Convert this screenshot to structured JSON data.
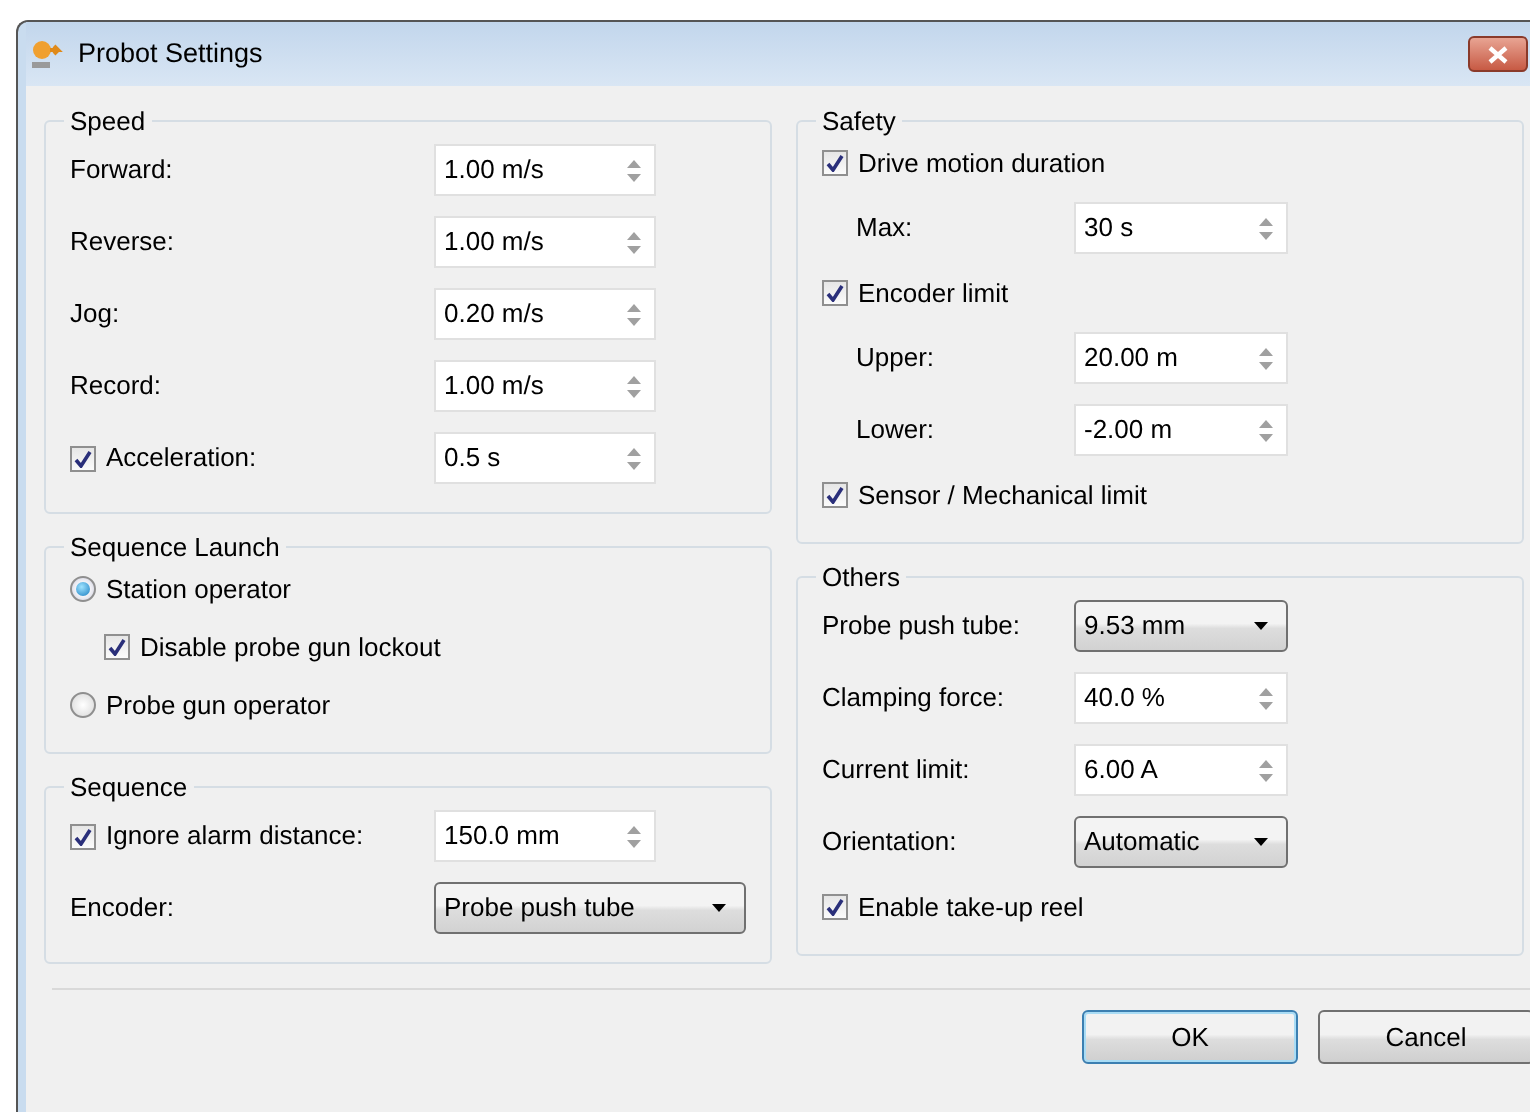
{
  "window": {
    "title": "Probot Settings"
  },
  "left_column": [
    {
      "title": "Speed",
      "items": [
        {
          "kind": "spin",
          "label": "Forward:",
          "value": "1.00 m/s"
        },
        {
          "kind": "spin",
          "label": "Reverse:",
          "value": "1.00 m/s"
        },
        {
          "kind": "spin",
          "label": "Jog:",
          "value": "0.20 m/s"
        },
        {
          "kind": "spin",
          "label": "Record:",
          "value": "1.00 m/s"
        },
        {
          "kind": "check_spin",
          "label": "Acceleration:",
          "checked": true,
          "value": "0.5 s"
        }
      ]
    },
    {
      "title": "Sequence Launch",
      "items": [
        {
          "kind": "radio",
          "label": "Station operator",
          "selected": true,
          "children": [
            {
              "kind": "check",
              "label": "Disable probe gun lockout",
              "checked": true
            }
          ]
        },
        {
          "kind": "radio",
          "label": "Probe gun operator",
          "selected": false
        }
      ]
    },
    {
      "title": "Sequence",
      "items": [
        {
          "kind": "check_spin",
          "label": "Ignore alarm distance:",
          "checked": true,
          "value": "150.0 mm"
        },
        {
          "kind": "combo",
          "label": "Encoder:",
          "value": "Probe push tube"
        }
      ]
    }
  ],
  "right_column": [
    {
      "title": "Safety",
      "items": [
        {
          "kind": "check",
          "label": "Drive motion duration",
          "checked": true,
          "children": [
            {
              "kind": "spin",
              "label": "Max:",
              "value": "30 s"
            }
          ]
        },
        {
          "kind": "check",
          "label": "Encoder limit",
          "checked": true,
          "children": [
            {
              "kind": "spin",
              "label": "Upper:",
              "value": "20.00 m"
            },
            {
              "kind": "spin",
              "label": "Lower:",
              "value": "-2.00 m"
            }
          ]
        },
        {
          "kind": "check",
          "label": "Sensor / Mechanical limit",
          "checked": true
        }
      ]
    },
    {
      "title": "Others",
      "items": [
        {
          "kind": "combo",
          "label": "Probe push tube:",
          "value": "9.53 mm"
        },
        {
          "kind": "spin",
          "label": "Clamping force:",
          "value": "40.0 %"
        },
        {
          "kind": "spin",
          "label": "Current limit:",
          "value": "6.00 A"
        },
        {
          "kind": "combo",
          "label": "Orientation:",
          "value": "Automatic"
        },
        {
          "kind": "check",
          "label": "Enable take-up reel",
          "checked": true
        }
      ]
    }
  ],
  "buttons": [
    {
      "label": "OK",
      "default": true
    },
    {
      "label": "Cancel",
      "default": false
    }
  ]
}
